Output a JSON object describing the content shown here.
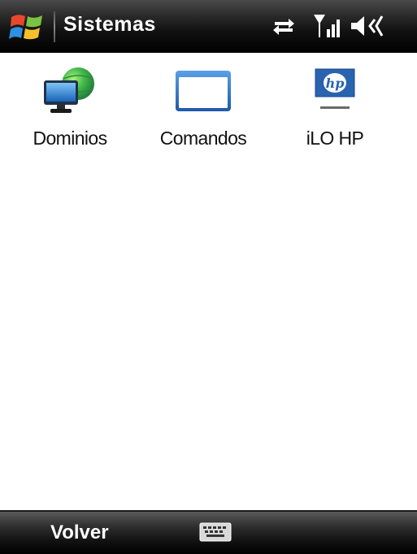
{
  "titlebar": {
    "title": "Sistemas",
    "start_icon": "windows-flag-icon",
    "status_icons": [
      "connectivity-arrows-icon",
      "signal-strength-icon",
      "speaker-volume-icon"
    ]
  },
  "apps": [
    {
      "label": "Dominios",
      "icon": "monitor-globe-icon"
    },
    {
      "label": "Comandos",
      "icon": "window-icon"
    },
    {
      "label": "iLO HP",
      "icon": "hp-logo-icon"
    }
  ],
  "softbar": {
    "left_label": "Volver",
    "center_icon": "keyboard-icon"
  },
  "colors": {
    "bar_dark": "#000000",
    "window_blue": "#2f6cc0",
    "hp_blue": "#1d5aa8"
  }
}
